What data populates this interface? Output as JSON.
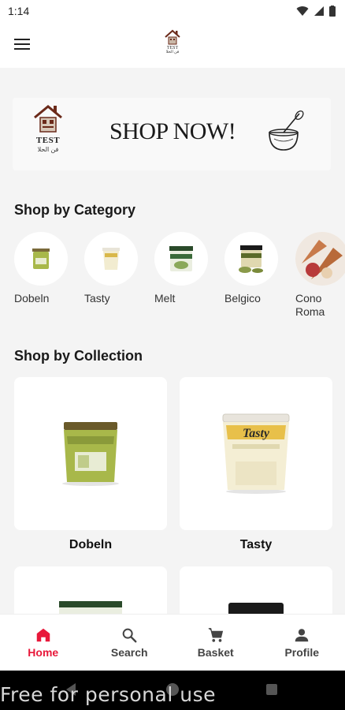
{
  "status_bar": {
    "time": "1:14"
  },
  "app_bar": {
    "logo_text": "TEST",
    "logo_sub": "فن الحلا"
  },
  "banner": {
    "brand": "TEST",
    "brand_sub": "فن الحلا",
    "text": "SHOP NOW!"
  },
  "categories": {
    "title": "Shop by Category",
    "items": [
      {
        "label": "Dobeln"
      },
      {
        "label": "Tasty"
      },
      {
        "label": "Melt"
      },
      {
        "label": "Belgico"
      },
      {
        "label": "Cono Roma"
      }
    ]
  },
  "collections": {
    "title": "Shop by Collection",
    "items": [
      {
        "label": "Dobeln"
      },
      {
        "label": "Tasty"
      }
    ],
    "tasty_jar_text": "Tasty"
  },
  "bottom_nav": {
    "items": [
      {
        "label": "Home",
        "icon": "home-icon",
        "active": true
      },
      {
        "label": "Search",
        "icon": "search-icon",
        "active": false
      },
      {
        "label": "Basket",
        "icon": "cart-icon",
        "active": false
      },
      {
        "label": "Profile",
        "icon": "person-icon",
        "active": false
      }
    ]
  },
  "watermark": "Free for personal use",
  "colors": {
    "accent": "#e8183a",
    "background": "#f4f4f4"
  }
}
